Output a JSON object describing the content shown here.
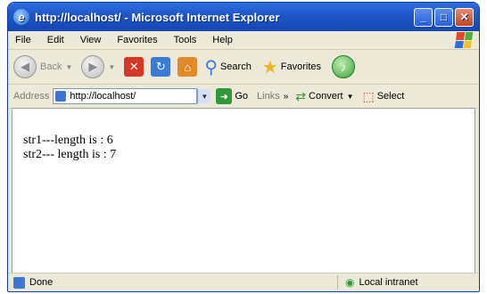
{
  "window": {
    "title": "http://localhost/ - Microsoft Internet Explorer",
    "controls": {
      "minimize": "_",
      "maximize": "□",
      "close": "✕"
    }
  },
  "menu": [
    "File",
    "Edit",
    "View",
    "Favorites",
    "Tools",
    "Help"
  ],
  "toolbar": {
    "back_label": "Back",
    "search_label": "Search",
    "favorites_label": "Favorites"
  },
  "address": {
    "label": "Address",
    "value": "http://localhost/",
    "go_label": "Go",
    "links_label": "Links",
    "convert_label": "Convert",
    "select_label": "Select"
  },
  "content": {
    "lines": [
      "str1---length is : 6",
      "str2--- length is : 7"
    ]
  },
  "status": {
    "left": "Done",
    "zone": "Local intranet"
  },
  "colors": {
    "titlebar": "#1d55c8",
    "chrome": "#ece9d8",
    "go": "#2f9a3a"
  },
  "icons": [
    "ie-logo-icon",
    "windows-flag-icon",
    "back-icon",
    "forward-icon",
    "stop-icon",
    "refresh-icon",
    "home-icon",
    "search-icon",
    "favorites-icon",
    "media-icon",
    "page-icon",
    "go-icon",
    "convert-icon",
    "select-icon",
    "done-icon",
    "intranet-icon"
  ]
}
